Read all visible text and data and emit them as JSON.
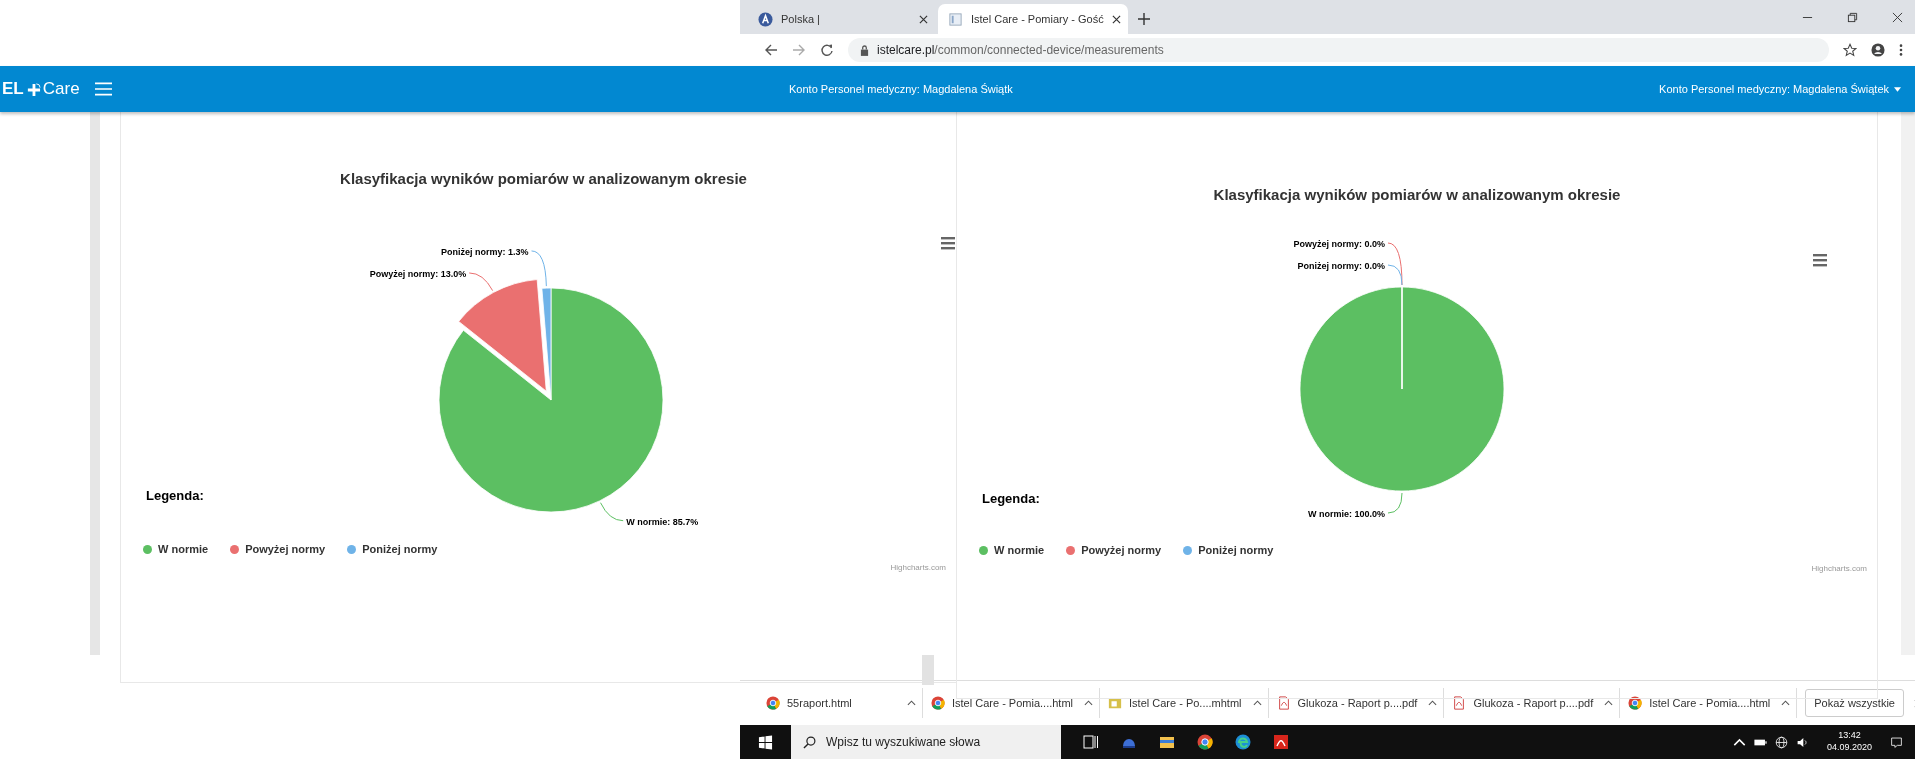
{
  "browser": {
    "tabs": [
      {
        "title": "Polska |",
        "selected": false
      },
      {
        "title": "Istel Care - Pomiary - Gość",
        "selected": true
      }
    ],
    "url_host": "istelcare.pl",
    "url_path": "/common/connected-device/measurements"
  },
  "header": {
    "logo_left": "EL",
    "logo_right": "Care",
    "account_center": "Konto Personel medyczny: Magdalena Świątk",
    "account_right": "Konto Personel medyczny: Magdalena Świątek"
  },
  "charts": [
    {
      "title": "Klasyfikacja wyników pomiarów w analizowanym okresie",
      "legend_title": "Legenda:",
      "credit": "Highcharts.com",
      "sliced": [
        false,
        true,
        false
      ],
      "chart_data": {
        "type": "pie",
        "categories": [
          "W normie",
          "Powyżej normy",
          "Poniżej normy"
        ],
        "series": [
          {
            "values": [
              85.7,
              13.0,
              1.3
            ]
          }
        ],
        "data_labels": "value_labels",
        "value_labels": [
          "W normie: 85.7%",
          "Powyżej normy: 13.0%",
          "Poniżej normy: 1.3%"
        ]
      },
      "legend": [
        {
          "color": "#5cbf62"
        },
        {
          "color": "#ea7070"
        },
        {
          "color": "#6fb3e8"
        }
      ]
    },
    {
      "title": "Klasyfikacja wyników pomiarów w analizowanym okresie",
      "legend_title": "Legenda:",
      "credit": "Highcharts.com",
      "chart_data": {
        "type": "pie",
        "categories": [
          "W normie",
          "Powyżej normy",
          "Poniżej normy"
        ],
        "series": [
          {
            "values": [
              100.0,
              0.0,
              0.0
            ]
          }
        ],
        "data_labels": "value_labels",
        "value_labels": [
          "W normie: 100.0%",
          "Powyżej normy: 0.0%",
          "Poniżej normy: 0.0%"
        ]
      },
      "legend": [
        {
          "color": "#5cbf62"
        },
        {
          "color": "#ea7070"
        },
        {
          "color": "#6fb3e8"
        }
      ]
    }
  ],
  "downloads": {
    "items": [
      {
        "name": "55raport.html",
        "kind": "chrome"
      },
      {
        "name": "Istel Care - Pomia....html",
        "kind": "chrome"
      },
      {
        "name": "Istel Care - Po....mhtml",
        "kind": "file"
      },
      {
        "name": "Glukoza - Raport p....pdf",
        "kind": "pdf"
      },
      {
        "name": "Glukoza - Raport p....pdf",
        "kind": "pdf"
      },
      {
        "name": "Istel Care - Pomia....html",
        "kind": "chrome"
      }
    ],
    "show_all": "Pokaż wszystkie"
  },
  "taskbar": {
    "search_placeholder": "Wpisz tu wyszukiwane słowa",
    "time": "13:42",
    "date": "04.09.2020"
  }
}
